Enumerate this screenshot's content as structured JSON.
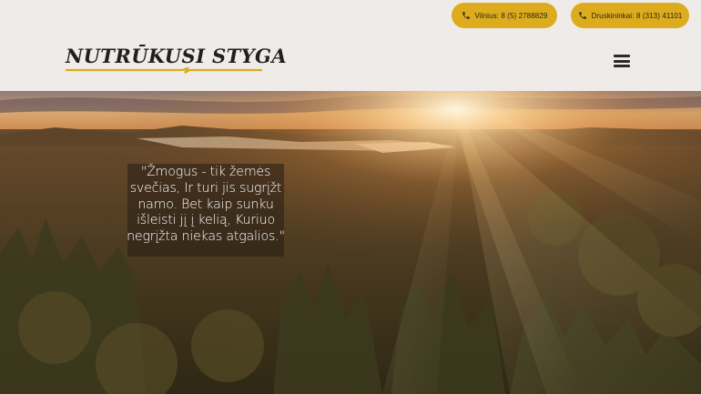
{
  "header": {
    "phones": [
      {
        "label": "Vilnius: 8 (5) 2788829",
        "icon": "phone-icon"
      },
      {
        "label": "Druskininkai: 8 (313) 41101",
        "icon": "phone-icon"
      }
    ],
    "logo_text": "NUTRŪKUSI STYGA",
    "menu_icon": "hamburger-menu-icon"
  },
  "hero": {
    "quote": "\"Žmogus - tik žemės svečias, Ir turi jis sugrįžt namo. Bet kaip sunku išleisti jį į kelią, Kuriuo negrįžta niekas atgalios.\""
  },
  "colors": {
    "accent": "#dcab1e",
    "header_bg": "#efebe8",
    "logo_text": "#1f1f1f"
  }
}
